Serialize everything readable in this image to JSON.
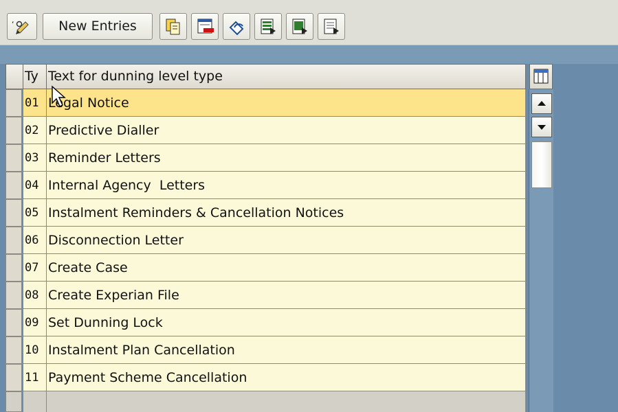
{
  "toolbar": {
    "new_entries_label": "New Entries",
    "buttons": [
      "display-change-icon",
      "copy-icon",
      "delete-icon",
      "undo-icon",
      "select-all-icon",
      "select-block-icon",
      "deselect-all-icon"
    ]
  },
  "table": {
    "columns": [
      "Ty",
      "Text for dunning level type"
    ],
    "rows": [
      {
        "code": "01",
        "text": "Legal Notice"
      },
      {
        "code": "02",
        "text": "Predictive Dialler"
      },
      {
        "code": "03",
        "text": "Reminder Letters"
      },
      {
        "code": "04",
        "text": "Internal Agency  Letters"
      },
      {
        "code": "05",
        "text": "Instalment Reminders & Cancellation Notices"
      },
      {
        "code": "06",
        "text": "Disconnection Letter"
      },
      {
        "code": "07",
        "text": "Create Case"
      },
      {
        "code": "08",
        "text": "Create Experian File"
      },
      {
        "code": "09",
        "text": "Set Dunning Lock"
      },
      {
        "code": "10",
        "text": "Instalment Plan Cancellation"
      },
      {
        "code": "11",
        "text": "Payment Scheme Cancellation"
      }
    ],
    "selected_row": "01"
  },
  "colors": {
    "row_bg": "#fbf9d8",
    "selected_row_bg": "#fde38a",
    "background": "#6a8ba9"
  }
}
